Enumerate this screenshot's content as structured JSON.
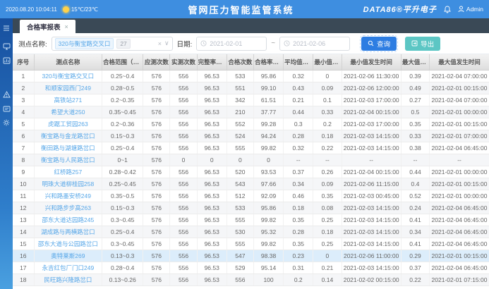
{
  "topbar": {
    "datetime": "2020.08.20 10:04:11",
    "weather": "15℃/23℃",
    "title": "管网压力智能监管系统",
    "brand": "DATA86®平升电子",
    "user": "Admin"
  },
  "sidebar": {
    "icons": [
      "menu-icon",
      "monitor-icon",
      "dashboard-icon",
      "alarm-icon",
      "report-icon",
      "settings-icon"
    ]
  },
  "tabs": [
    {
      "label": "合格率报表",
      "close": "×"
    }
  ],
  "filters": {
    "site_label": "测点名称:",
    "site_tag": "320与衡宝路交叉口",
    "site_count": "27",
    "clear": "×",
    "caret": "∨",
    "date_label": "日期:",
    "date_from": "2021-02-01",
    "date_to": "2021-02-06",
    "range_sep": "~",
    "search_label": "查询",
    "export_label": "导出"
  },
  "table": {
    "columns": [
      "序号",
      "测点名称",
      "合格范围（MPa）",
      "应测次数",
      "实测次数",
      "完整率（%）",
      "合格次数",
      "合格率（%）",
      "平均值（MPa）",
      "最小值（MPa）",
      "最小值发生时间",
      "最大值（MPa）",
      "最大值发生时间"
    ],
    "highlighted_row_index": 15,
    "rows": [
      [
        "1",
        "320与衡宝路交叉口",
        "0.25~0.4",
        "576",
        "556",
        "96.53",
        "533",
        "95.86",
        "0.32",
        "0",
        "2021-02-06 11:30:00",
        "0.39",
        "2021-02-04 07:00:00"
      ],
      [
        "2",
        "和顺家园西门249",
        "0.28~0.5",
        "576",
        "556",
        "96.53",
        "551",
        "99.10",
        "0.43",
        "0.09",
        "2021-02-06 12:00:00",
        "0.49",
        "2021-02-01 00:15:00"
      ],
      [
        "3",
        "高铁站271",
        "0.2~0.35",
        "576",
        "556",
        "96.53",
        "342",
        "61.51",
        "0.21",
        "0.1",
        "2021-02-03 17:00:00",
        "0.27",
        "2021-02-04 07:00:00"
      ],
      [
        "4",
        "希望大道250",
        "0.35~0.45",
        "576",
        "556",
        "96.53",
        "210",
        "37.77",
        "0.44",
        "0.33",
        "2021-02-04 00:15:00",
        "0.5",
        "2021-02-01 00:00:00"
      ],
      [
        "5",
        "虎踞工贸园263",
        "0.2~0.36",
        "576",
        "556",
        "96.53",
        "552",
        "99.28",
        "0.3",
        "0.2",
        "2021-02-03 17:00:00",
        "0.35",
        "2021-02-01 00:15:00"
      ],
      [
        "6",
        "衡宝路与金龙路岔口",
        "0.15~0.3",
        "576",
        "556",
        "96.53",
        "524",
        "94.24",
        "0.28",
        "0.18",
        "2021-02-03 14:15:00",
        "0.33",
        "2021-02-01 07:00:00"
      ],
      [
        "7",
        "衡田路与湖塘路岔口",
        "0.25~0.4",
        "576",
        "556",
        "96.53",
        "555",
        "99.82",
        "0.32",
        "0.22",
        "2021-02-03 14:15:00",
        "0.38",
        "2021-02-04 06:45:00"
      ],
      [
        "8",
        "衡宝路与人民路岔口",
        "0~1",
        "576",
        "0",
        "0",
        "0",
        "0",
        "--",
        "--",
        "--",
        "--",
        "--"
      ],
      [
        "9",
        "红桥路257",
        "0.28~0.42",
        "576",
        "556",
        "96.53",
        "520",
        "93.53",
        "0.37",
        "0.26",
        "2021-02-04 00:15:00",
        "0.44",
        "2021-02-01 00:00:00"
      ],
      [
        "10",
        "明珠大道柳桂园258",
        "0.25~0.45",
        "576",
        "556",
        "96.53",
        "543",
        "97.66",
        "0.34",
        "0.09",
        "2021-02-06 11:15:00",
        "0.4",
        "2021-02-01 00:15:00"
      ],
      [
        "11",
        "兴和路墨安桥249",
        "0.35~0.5",
        "576",
        "556",
        "96.53",
        "512",
        "92.09",
        "0.46",
        "0.35",
        "2021-02-03 00:45:00",
        "0.52",
        "2021-02-01 00:00:00"
      ],
      [
        "12",
        "兴和路步步高263",
        "0.15~0.3",
        "576",
        "556",
        "96.53",
        "533",
        "95.86",
        "0.18",
        "0.08",
        "2021-02-03 14:15:00",
        "0.24",
        "2021-02-04 06:45:00"
      ],
      [
        "13",
        "邵东大道达园路245",
        "0.3~0.45",
        "576",
        "556",
        "96.53",
        "555",
        "99.82",
        "0.35",
        "0.25",
        "2021-02-03 14:15:00",
        "0.41",
        "2021-02-04 06:45:00"
      ],
      [
        "14",
        "湖成路与两横路岔口",
        "0.25~0.4",
        "576",
        "556",
        "96.53",
        "530",
        "95.32",
        "0.28",
        "0.18",
        "2021-02-03 14:15:00",
        "0.34",
        "2021-02-04 06:45:00"
      ],
      [
        "15",
        "邵东大道与公园路岔口",
        "0.3~0.45",
        "576",
        "556",
        "96.53",
        "555",
        "99.82",
        "0.35",
        "0.25",
        "2021-02-03 14:15:00",
        "0.41",
        "2021-02-04 06:45:00"
      ],
      [
        "16",
        "奥特莱斯269",
        "0.13~0.3",
        "576",
        "556",
        "96.53",
        "547",
        "98.38",
        "0.23",
        "0",
        "2021-02-06 11:00:00",
        "0.29",
        "2021-02-01 00:15:00"
      ],
      [
        "17",
        "永吉红包厂门口249",
        "0.28~0.4",
        "576",
        "556",
        "96.53",
        "529",
        "95.14",
        "0.31",
        "0.21",
        "2021-02-03 14:15:00",
        "0.37",
        "2021-02-04 06:45:00"
      ],
      [
        "18",
        "民旺路兴隆路岔口",
        "0.13~0.26",
        "576",
        "556",
        "96.53",
        "556",
        "100",
        "0.2",
        "0.14",
        "2021-02-02 00:15:00",
        "0.22",
        "2021-02-01 07:15:00"
      ]
    ]
  },
  "colors": {
    "topbar_blue": "#3e8ee0",
    "accent_blue": "#2d7de2",
    "teal": "#5cc6c4",
    "link_blue": "#57a7e8",
    "highlight_row": "#dcedfb",
    "tabbar_dark": "#3a4956"
  }
}
